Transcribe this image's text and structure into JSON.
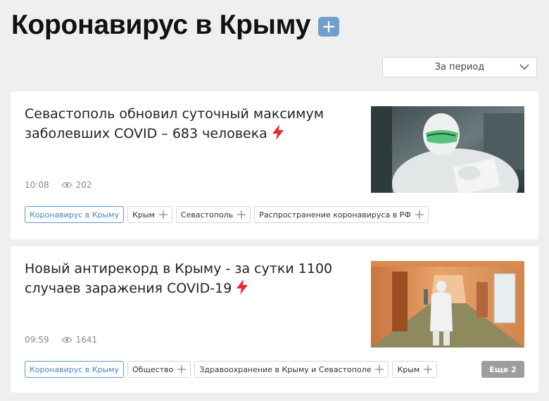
{
  "header": {
    "title": "Коронавирус в Крыму",
    "subscribe_icon": "plus-icon"
  },
  "filter": {
    "period_label": "За период",
    "icon": "chevron-down-icon"
  },
  "colors": {
    "accent_blue": "#6fa0cc",
    "tag_active": "#4a86b8",
    "bolt_red": "#e6272d",
    "more_button": "#9d9d9d"
  },
  "articles": [
    {
      "title": "Севастополь обновил суточный максимум заболевших COVID – 683 человека",
      "icon": "lightning-icon",
      "time": "10:08",
      "views": "202",
      "image": "doctor-in-protective-suit-photo",
      "tags": [
        {
          "label": "Коронавирус в Крыму",
          "active": true
        },
        {
          "label": "Крым",
          "active": false
        },
        {
          "label": "Севастополь",
          "active": false
        },
        {
          "label": "Распространение коронавируса в РФ",
          "active": false
        }
      ]
    },
    {
      "title": "Новый антирекорд в Крыму - за сутки 1100 случаев заражения COVID-19",
      "icon": "lightning-icon",
      "time": "09:59",
      "views": "1641",
      "image": "hospital-corridor-photo",
      "tags": [
        {
          "label": "Коронавирус в Крыму",
          "active": true
        },
        {
          "label": "Общество",
          "active": false
        },
        {
          "label": "Здравоохранение в Крыму и Севастополе",
          "active": false
        },
        {
          "label": "Крым",
          "active": false
        }
      ],
      "more_label": "Еще 2"
    }
  ]
}
